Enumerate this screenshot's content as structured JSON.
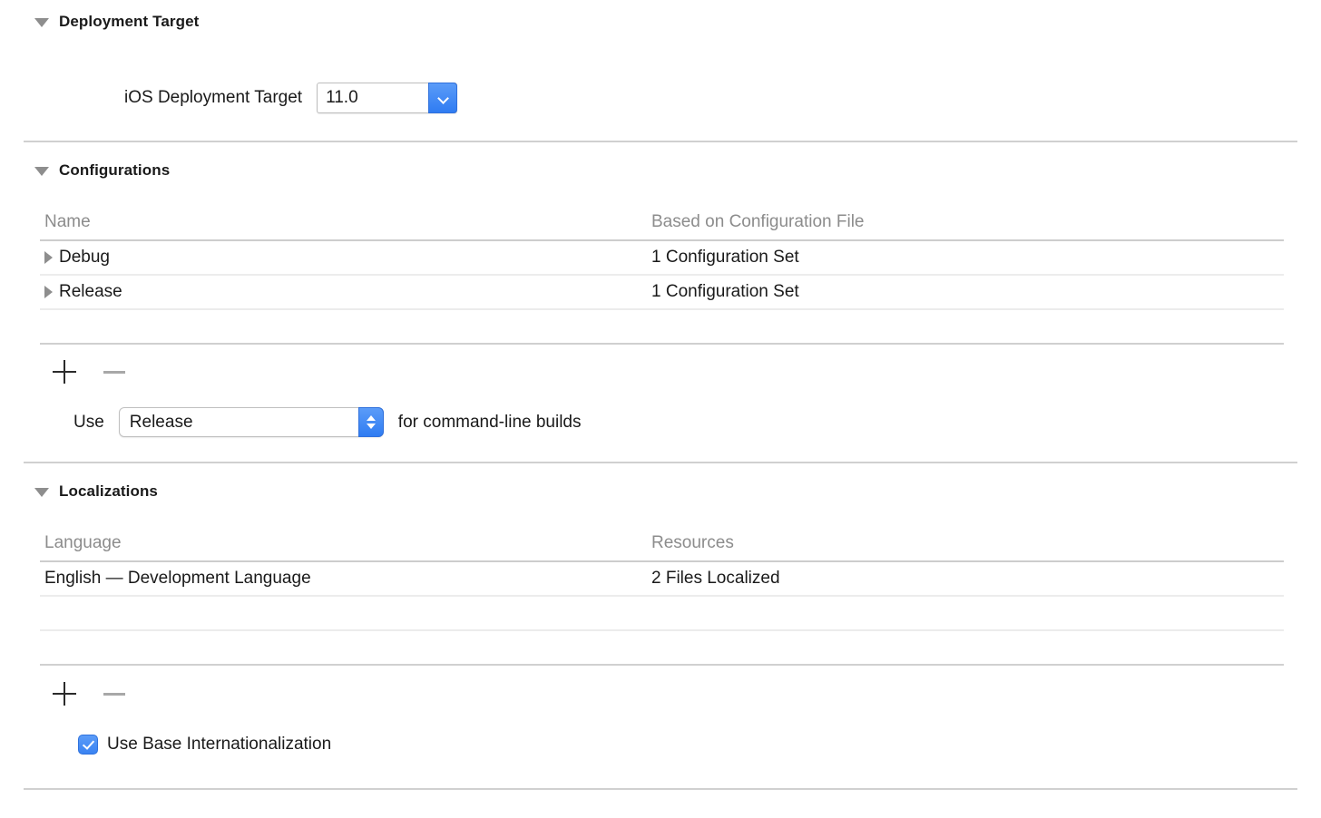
{
  "sections": {
    "deployment_target": {
      "title": "Deployment Target",
      "disclosure_icon": "triangle-down-icon",
      "field": {
        "label": "iOS Deployment Target",
        "value": "11.0",
        "control_icon": "chevron-down-icon"
      }
    },
    "configurations": {
      "title": "Configurations",
      "disclosure_icon": "triangle-down-icon",
      "table": {
        "columns": [
          "Name",
          "Based on Configuration File"
        ],
        "rows": [
          {
            "name": "Debug",
            "based_on": "1 Configuration Set",
            "disclosure_icon": "triangle-right-icon"
          },
          {
            "name": "Release",
            "based_on": "1 Configuration Set",
            "disclosure_icon": "triangle-right-icon"
          }
        ]
      },
      "add_button_label": "+",
      "remove_button_label": "−",
      "command_line": {
        "prefix": "Use",
        "value": "Release",
        "suffix": "for command-line builds",
        "control_icon": "stepper-up-down-icon"
      }
    },
    "localizations": {
      "title": "Localizations",
      "disclosure_icon": "triangle-down-icon",
      "table": {
        "columns": [
          "Language",
          "Resources"
        ],
        "rows": [
          {
            "language": "English — Development Language",
            "resources": "2 Files Localized"
          }
        ]
      },
      "add_button_label": "+",
      "remove_button_label": "−",
      "base_internationalization": {
        "label": "Use Base Internationalization",
        "checked": true,
        "check_icon": "checkmark-icon"
      }
    }
  },
  "colors": {
    "accent_blue": "#3a83f2",
    "divider": "#d0d0d0",
    "header_text": "#8c8c8c",
    "body_text": "#1a1a1a"
  }
}
